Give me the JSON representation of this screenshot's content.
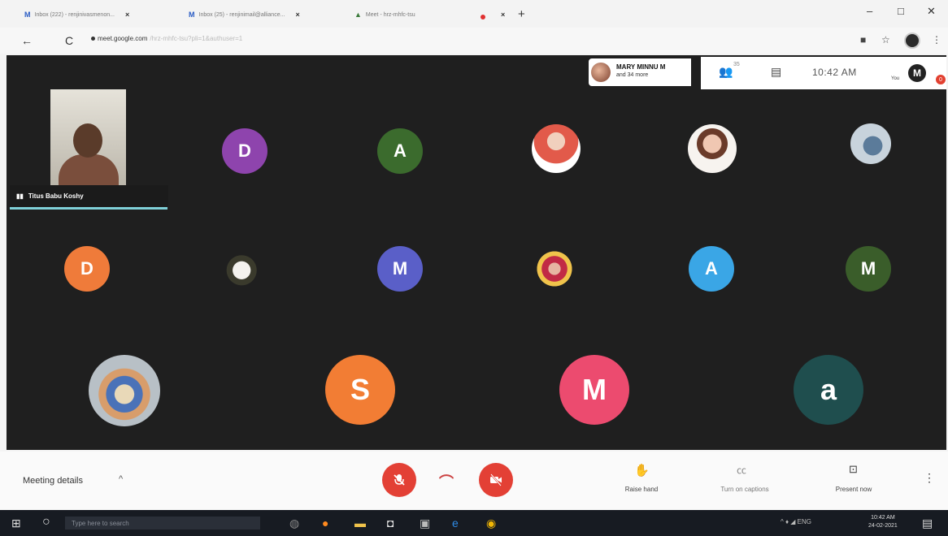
{
  "browser": {
    "tabs": [
      {
        "icon": "M",
        "title": "Inbox (222) - renjinivasmenon...",
        "close": "×"
      },
      {
        "icon": "M",
        "title": "Inbox (25) - renjinimail@alliance...",
        "close": "×"
      },
      {
        "icon": "▲",
        "title": "Meet - hrz-mhfc-tsu",
        "close": "×"
      }
    ],
    "new_tab": "+",
    "window_controls": {
      "minimize": "–",
      "maximize": "□",
      "close": "✕"
    },
    "url_host": "meet.google.com",
    "url_path": "/hrz-mhfc-tsu?pli=1&authuser=1",
    "nav": {
      "back": "←",
      "reload": "C"
    },
    "right_icons": {
      "camera": "■",
      "star": "☆",
      "menu": "⋮"
    }
  },
  "meeting": {
    "self_name": "Titus Babu Koshy",
    "presenter_line1": "MARY MINNU M",
    "presenter_line2": "and 34 more",
    "participants_badge": "35",
    "time": "10:42 AM",
    "you_label": "You",
    "you_initial": "M",
    "notification_count": "0",
    "avatars": [
      {
        "letter": "D",
        "color": "#8e44ad"
      },
      {
        "letter": "A",
        "color": "#3b6b2d"
      },
      {
        "letter": "D",
        "color": "#ef7b3a"
      },
      {
        "letter": "M",
        "color": "#5a5fc8"
      },
      {
        "letter": "A",
        "color": "#3aa6e6"
      },
      {
        "letter": "M",
        "color": "#3a5d2a"
      },
      {
        "letter": "S",
        "color": "#f27d34"
      },
      {
        "letter": "M",
        "color": "#ec4b6f"
      },
      {
        "letter": "a",
        "color": "#1f4e4e"
      }
    ]
  },
  "controls": {
    "meeting_details": "Meeting details",
    "chevron": "^",
    "raise_hand": "Raise hand",
    "captions": "Turn on captions",
    "present": "Present now",
    "more": "⋮"
  },
  "taskbar": {
    "search_placeholder": "Type here to search",
    "tray": "^ ♦ ◢ ENG",
    "clock_time": "10:42 AM",
    "clock_date": "24-02-2021"
  }
}
